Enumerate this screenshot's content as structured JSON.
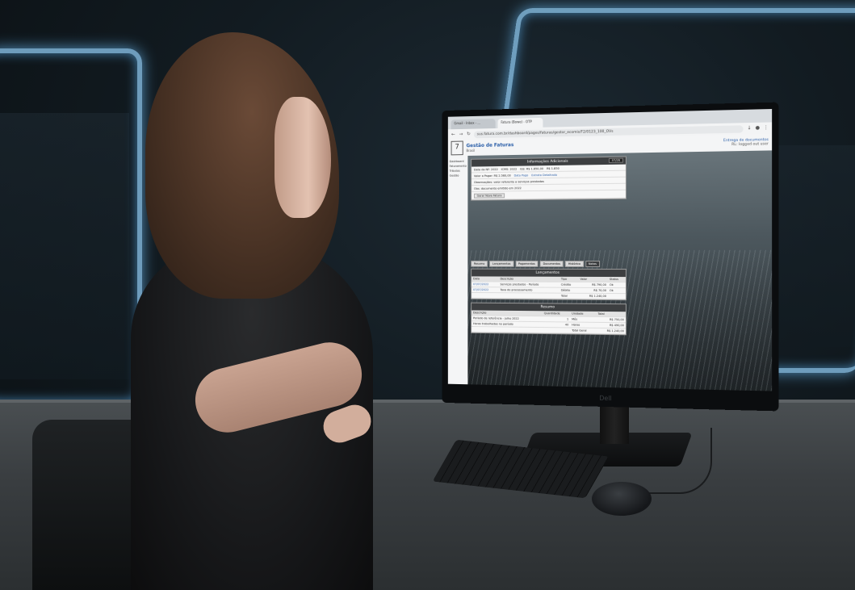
{
  "browser": {
    "tabs": [
      "Gmail - Inbox - ...",
      "Fatura (Bowe) - OTP"
    ],
    "url": "sus.fatura.com.br/dashboard/pages/faturas/gestor_ecomis/F2/0123_100_OVs",
    "icons": [
      "back-icon",
      "forward-icon",
      "reload-icon",
      "download-icon",
      "profile-icon",
      "menu-icon"
    ]
  },
  "app": {
    "logo": "7",
    "title": "Gestão de Faturas",
    "subtitle": "Brasil",
    "header_right_title": "Entrega de documentos",
    "header_right_sub": "RL: logged out user"
  },
  "left_nav": [
    "Dashboard",
    "Faturamento",
    "Tributos",
    "Gestão"
  ],
  "panel1": {
    "title": "Informações Adicionais",
    "chip": "07/26",
    "rows": [
      [
        "Data da NF: 2022",
        "ICMS: 2022",
        "ISS: R$ 1.850,00",
        "R$ 1.850"
      ],
      [
        "Valor a Pagar: R$ 2.560,00",
        "Data Pago",
        "Extrato Detalhado"
      ],
      [
        "Observações: valor referente a serviços prestados"
      ],
      [
        "Obs: documento emitido em 2022"
      ]
    ],
    "button": "Gerar Nova Fatura"
  },
  "tabs": [
    "Resumo",
    "Lançamentos",
    "Pagamentos",
    "Documentos",
    "Histórico",
    "Notas"
  ],
  "selected_tab": "Notas",
  "panel2": {
    "title": "Lançamentos",
    "columns": [
      "Data",
      "Descrição",
      "Tipo",
      "Valor",
      "Status"
    ],
    "rows": [
      [
        "07/07/2022",
        "Serviços prestados - Período",
        "Crédito",
        "R$ 790,00",
        "Ok"
      ],
      [
        "07/07/2022",
        "Taxa de processamento",
        "Débito",
        "R$ 70,00",
        "Ok"
      ]
    ],
    "total_label": "Total",
    "total_value": "R$ 1.240,00"
  },
  "panel3": {
    "title": "Resumo",
    "columns": [
      "Descrição",
      "Quantidade",
      "Unidade",
      "Total"
    ],
    "rows": [
      [
        "Período de referência - julho 2022",
        "1",
        "Mês",
        "R$ 750,00"
      ],
      [
        "Horas trabalhadas no período",
        "40",
        "Horas",
        "R$ 490,00"
      ]
    ],
    "total_label": "Total Geral",
    "total_value": "R$ 1.240,00"
  },
  "monitor_brand": "Dell"
}
